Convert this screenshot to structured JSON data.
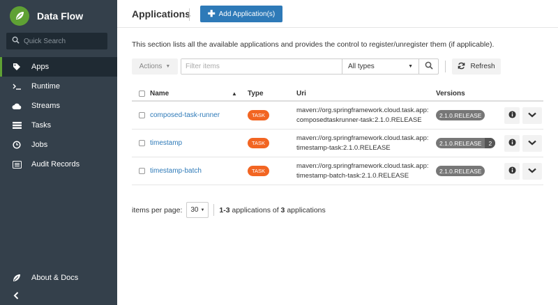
{
  "brand": {
    "title": "Data Flow"
  },
  "search": {
    "placeholder": "Quick Search"
  },
  "nav": [
    {
      "label": "Apps",
      "icon": "tags-icon"
    },
    {
      "label": "Runtime",
      "icon": "terminal-icon"
    },
    {
      "label": "Streams",
      "icon": "cloud-icon"
    },
    {
      "label": "Tasks",
      "icon": "tasks-icon"
    },
    {
      "label": "Jobs",
      "icon": "clock-icon"
    },
    {
      "label": "Audit Records",
      "icon": "list-icon"
    }
  ],
  "about": {
    "label": "About & Docs"
  },
  "header": {
    "title": "Applications",
    "add_button": "Add Application(s)"
  },
  "description": "This section lists all the available applications and provides the control to register/unregister them (if applicable).",
  "toolbar": {
    "actions": "Actions",
    "filter_placeholder": "Filter items",
    "type_select": "All types",
    "refresh": "Refresh"
  },
  "table": {
    "columns": {
      "name": "Name",
      "type": "Type",
      "uri": "Uri",
      "versions": "Versions"
    },
    "rows": [
      {
        "name": "composed-task-runner",
        "type": "TASK",
        "uri_line1": "maven://org.springframework.cloud.task.app:",
        "uri_line2": "composedtaskrunner-task:2.1.0.RELEASE",
        "version": "2.1.0.RELEASE",
        "version_count": ""
      },
      {
        "name": "timestamp",
        "type": "TASK",
        "uri_line1": "maven://org.springframework.cloud.task.app:",
        "uri_line2": "timestamp-task:2.1.0.RELEASE",
        "version": "2.1.0.RELEASE",
        "version_count": "2"
      },
      {
        "name": "timestamp-batch",
        "type": "TASK",
        "uri_line1": "maven://org.springframework.cloud.task.app:",
        "uri_line2": "timestamp-batch-task:2.1.0.RELEASE",
        "version": "2.1.0.RELEASE",
        "version_count": ""
      }
    ]
  },
  "pager": {
    "label": "items per page:",
    "per_page": "30",
    "range": "1-3",
    "text_mid": "applications of",
    "total": "3",
    "text_end": "applications"
  },
  "colors": {
    "sidebar": "#34404b",
    "accent": "#5fa134",
    "primary": "#2e7ab8",
    "task_badge": "#f26522"
  }
}
